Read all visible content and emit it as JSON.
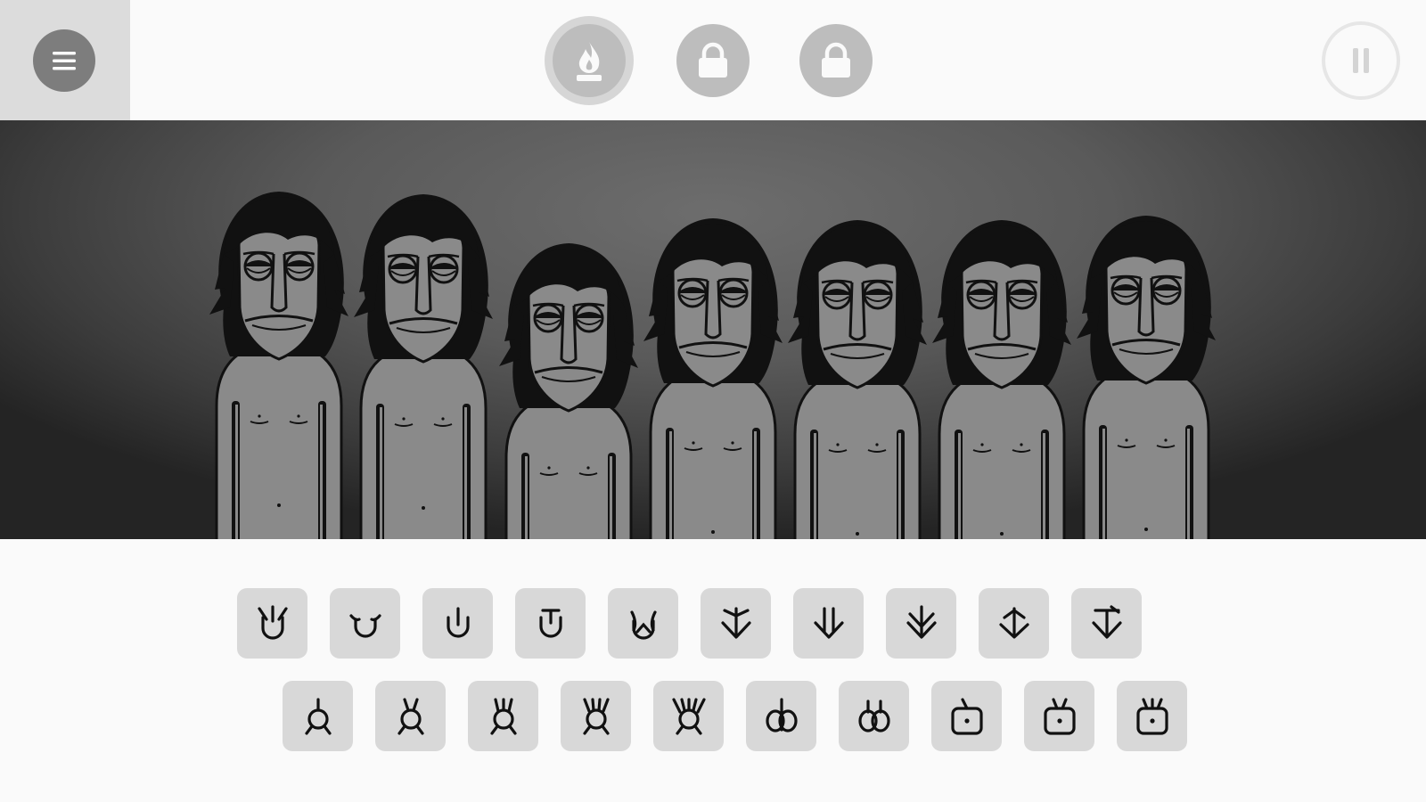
{
  "topbar": {
    "menu_icon": "hamburger-icon",
    "bonus_buttons": [
      {
        "icon": "flame-icon",
        "state": "unlocked"
      },
      {
        "icon": "lock-icon",
        "state": "locked"
      },
      {
        "icon": "lock-icon",
        "state": "locked"
      }
    ],
    "pause_icon": "pause-icon"
  },
  "stage": {
    "performers": 7,
    "state": "idle"
  },
  "palette": {
    "rows": [
      [
        "horns-1",
        "horns-2",
        "horns-3",
        "horns-4",
        "horns-5",
        "arrow-1",
        "arrow-2",
        "arrow-3",
        "arrow-4",
        "arrow-5"
      ],
      [
        "antenna-1",
        "antenna-2",
        "antenna-3",
        "antenna-4",
        "antenna-5",
        "pod-1",
        "pod-2",
        "box-1",
        "box-2",
        "box-3"
      ]
    ]
  },
  "colors": {
    "background": "#fafafa",
    "menu_panel": "#dcdcdc",
    "button_gray": "#bdbdbd",
    "icon_tile": "#d8d8d8",
    "glyph": "#111111",
    "figure_skin": "#8a8a8a"
  }
}
